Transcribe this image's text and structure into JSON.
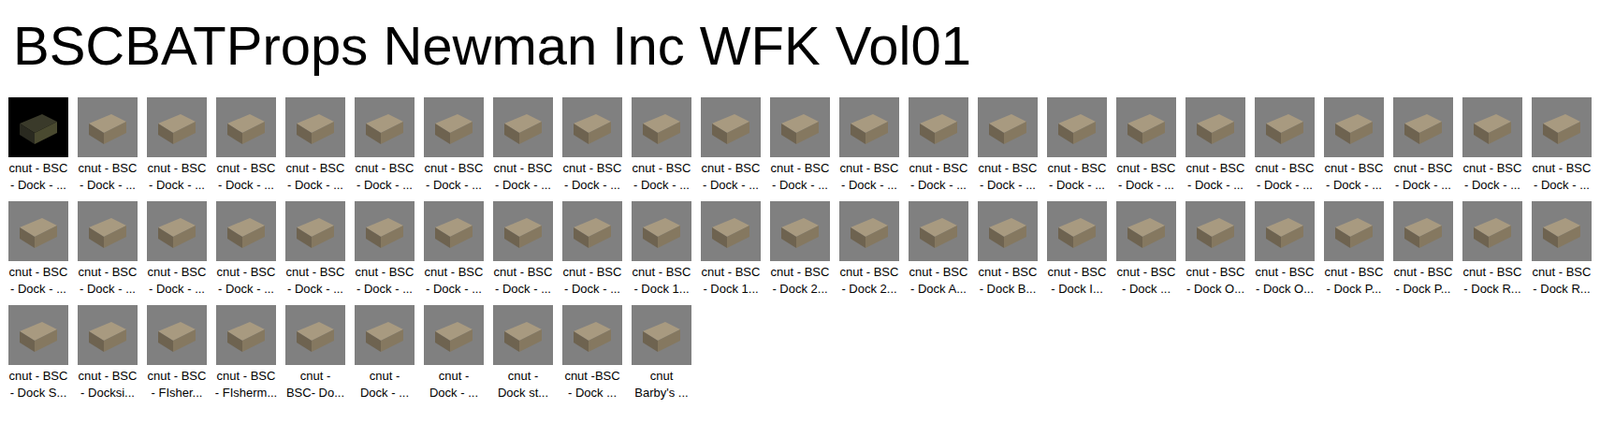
{
  "window": {
    "title": "BSCBATProps Newman Inc WFK Vol01"
  },
  "rows": [
    [
      {
        "line1": "cnut - BSC",
        "line2": "- Dock - ...",
        "kind": "dark"
      },
      {
        "line1": "cnut - BSC",
        "line2": "- Dock - ...",
        "kind": "plain"
      },
      {
        "line1": "cnut - BSC",
        "line2": "- Dock - ...",
        "kind": "plain"
      },
      {
        "line1": "cnut - BSC",
        "line2": "- Dock - ...",
        "kind": "plain"
      },
      {
        "line1": "cnut - BSC",
        "line2": "- Dock - ...",
        "kind": "plain"
      },
      {
        "line1": "cnut - BSC",
        "line2": "- Dock - ...",
        "kind": "plain"
      },
      {
        "line1": "cnut - BSC",
        "line2": "- Dock - ...",
        "kind": "plain"
      },
      {
        "line1": "cnut - BSC",
        "line2": "- Dock - ...",
        "kind": "plain"
      },
      {
        "line1": "cnut - BSC",
        "line2": "- Dock - ...",
        "kind": "plain"
      },
      {
        "line1": "cnut - BSC",
        "line2": "- Dock - ...",
        "kind": "plain"
      },
      {
        "line1": "cnut - BSC",
        "line2": "- Dock - ...",
        "kind": "plain"
      },
      {
        "line1": "cnut - BSC",
        "line2": "- Dock - ...",
        "kind": "plain"
      },
      {
        "line1": "cnut - BSC",
        "line2": "- Dock - ...",
        "kind": "plain"
      },
      {
        "line1": "cnut - BSC",
        "line2": "- Dock - ...",
        "kind": "plain"
      },
      {
        "line1": "cnut - BSC",
        "line2": "- Dock - ...",
        "kind": "plain"
      },
      {
        "line1": "cnut - BSC",
        "line2": "- Dock - ...",
        "kind": "plain"
      },
      {
        "line1": "cnut - BSC",
        "line2": "- Dock - ...",
        "kind": "plain"
      },
      {
        "line1": "cnut - BSC",
        "line2": "- Dock - ...",
        "kind": "plain"
      },
      {
        "line1": "cnut - BSC",
        "line2": "- Dock - ...",
        "kind": "plain"
      },
      {
        "line1": "cnut - BSC",
        "line2": "- Dock - ...",
        "kind": "plain"
      },
      {
        "line1": "cnut - BSC",
        "line2": "- Dock - ...",
        "kind": "plain"
      },
      {
        "line1": "cnut - BSC",
        "line2": "- Dock - ...",
        "kind": "plain"
      },
      {
        "line1": "cnut - BSC",
        "line2": "- Dock - ...",
        "kind": "plain"
      }
    ],
    [
      {
        "line1": "cnut - BSC",
        "line2": "- Dock - ...",
        "kind": "plain"
      },
      {
        "line1": "cnut - BSC",
        "line2": "- Dock - ...",
        "kind": "plain"
      },
      {
        "line1": "cnut - BSC",
        "line2": "- Dock - ...",
        "kind": "plain"
      },
      {
        "line1": "cnut - BSC",
        "line2": "- Dock - ...",
        "kind": "plain"
      },
      {
        "line1": "cnut - BSC",
        "line2": "- Dock - ...",
        "kind": "plain"
      },
      {
        "line1": "cnut - BSC",
        "line2": "- Dock - ...",
        "kind": "plain"
      },
      {
        "line1": "cnut - BSC",
        "line2": "- Dock - ...",
        "kind": "plain"
      },
      {
        "line1": "cnut - BSC",
        "line2": "- Dock - ...",
        "kind": "plain"
      },
      {
        "line1": "cnut - BSC",
        "line2": "- Dock - ...",
        "kind": "plain"
      },
      {
        "line1": "cnut - BSC",
        "line2": "- Dock 1...",
        "kind": "plain"
      },
      {
        "line1": "cnut - BSC",
        "line2": "- Dock 1...",
        "kind": "plain"
      },
      {
        "line1": "cnut - BSC",
        "line2": "- Dock 2...",
        "kind": "plain"
      },
      {
        "line1": "cnut - BSC",
        "line2": "- Dock 2...",
        "kind": "plain"
      },
      {
        "line1": "cnut - BSC",
        "line2": "- Dock A...",
        "kind": "plain"
      },
      {
        "line1": "cnut - BSC",
        "line2": "- Dock B...",
        "kind": "plain"
      },
      {
        "line1": "cnut - BSC",
        "line2": "- Dock I...",
        "kind": "plain"
      },
      {
        "line1": "cnut - BSC",
        "line2": "- Dock ...",
        "kind": "plain"
      },
      {
        "line1": "cnut - BSC",
        "line2": "- Dock O...",
        "kind": "plain"
      },
      {
        "line1": "cnut - BSC",
        "line2": "- Dock O...",
        "kind": "plain"
      },
      {
        "line1": "cnut - BSC",
        "line2": "- Dock P...",
        "kind": "plain"
      },
      {
        "line1": "cnut - BSC",
        "line2": "- Dock P...",
        "kind": "plain"
      },
      {
        "line1": "cnut - BSC",
        "line2": "- Dock R...",
        "kind": "plain"
      },
      {
        "line1": "cnut - BSC",
        "line2": "- Dock R...",
        "kind": "plain"
      }
    ],
    [
      {
        "line1": "cnut - BSC",
        "line2": "- Dock S...",
        "kind": "plain"
      },
      {
        "line1": "cnut - BSC",
        "line2": "- Docksi...",
        "kind": "plain"
      },
      {
        "line1": "cnut - BSC",
        "line2": "- FIsher...",
        "kind": "plain"
      },
      {
        "line1": "cnut - BSC",
        "line2": "- FIsherm...",
        "kind": "plain"
      },
      {
        "line1": "cnut -",
        "line2": "BSC- Do...",
        "kind": "plain"
      },
      {
        "line1": "cnut -",
        "line2": "Dock - ...",
        "kind": "plain"
      },
      {
        "line1": "cnut -",
        "line2": "Dock - ...",
        "kind": "plain"
      },
      {
        "line1": "cnut -",
        "line2": "Dock st...",
        "kind": "plain"
      },
      {
        "line1": "cnut -BSC",
        "line2": "- Dock ...",
        "kind": "plain"
      },
      {
        "line1": "cnut",
        "line2": "Barby's ...",
        "kind": "plain"
      }
    ]
  ]
}
